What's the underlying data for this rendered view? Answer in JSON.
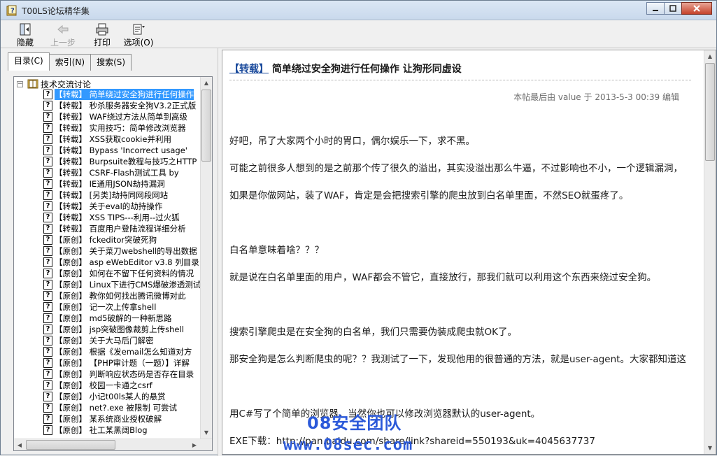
{
  "window": {
    "title": "T00LS论坛精华集"
  },
  "toolbar": {
    "hide_label": "隐藏",
    "back_label": "上一步",
    "print_label": "打印",
    "options_label": "选项(O)"
  },
  "tabs": [
    {
      "label": "目录(C)"
    },
    {
      "label": "索引(N)"
    },
    {
      "label": "搜索(S)"
    }
  ],
  "tree": {
    "root_label": "技术交流讨论",
    "items": [
      "【转载】 简单绕过安全狗进行任何操作",
      "【转载】 秒杀服务器安全狗V3.2正式版",
      "【转载】 WAF绕过方法从简单到高级",
      "【转载】 实用技巧：简单修改浏览器",
      "【转载】 XSS获取cookie并利用",
      "【转载】 Bypass 'Incorrect usage'",
      "【转载】 Burpsuite教程与技巧之HTTP",
      "【转载】 CSRF-Flash测试工具 by",
      "【转载】 IE通用JSON劫持漏洞",
      "【转载】 [另类]劫持同网段网站",
      "【转载】 关于eval的劫持操作",
      "【转载】 XSS TIPS---利用--过火狐",
      "【转载】 百度用户登陆流程详细分析",
      "【原创】 fckeditor突破死狗",
      "【原创】 关于菜刀webshell的导出数据",
      "【原创】 asp eWebEditor v3.8 列目录",
      "【原创】 如何在不留下任何资料的情况",
      "【原创】 Linux下进行CMS爆破渗透测试",
      "【原创】 教你如何找出腾讯微博对此",
      "【原创】 记一次上传拿shell",
      "【原创】 md5破解的一种新思路",
      "【原创】 jsp突破图像裁剪上传shell",
      "【原创】 关于大马后门解密",
      "【原创】 根据《发email怎么知道对方",
      "【原创】 【PHP审计题（一题）】详解",
      "【原创】 判断响应状态码是否存在目录",
      "【原创】 校园一卡通之csrf",
      "【原创】 小记t00ls某人的悬赏",
      "【原创】 net?.exe 被限制 可尝试",
      "【原创】 某系统商业授权破解",
      "【原创】 社工某黑阔Blog"
    ]
  },
  "article": {
    "title_tag": "【转载】",
    "title_text": "简单绕过安全狗进行任何操作  让狗形同虚设",
    "edit_note": "本帖最后由 value 于 2013-5-3 00:39 编辑",
    "paragraphs": [
      "好吧，吊了大家两个小时的胃口，偶尔娱乐一下，求不黑。",
      "可能之前很多人想到的是之前那个传了很久的溢出，其实没溢出那么牛逼，不过影响也不小，一个逻辑漏洞，",
      "如果是你做网站，装了WAF，肯定是会把搜索引擎的爬虫放到白名单里面，不然SEO就蛋疼了。",
      "白名单意味着啥？？？",
      "就是说在白名单里面的用户，WAF都会不管它，直接放行，那我们就可以利用这个东西来绕过安全狗。",
      "搜索引擎爬虫是在安全狗的白名单，我们只需要伪装成爬虫就OK了。",
      "那安全狗是怎么判断爬虫的呢？？我测试了一下，发现他用的很普通的方法，就是user-agent。大家都知道这",
      "用C#写了个简单的浏览器，当然你也可以修改浏览器默认的user-agent。",
      "EXE下载：http://pan.baidu.com/share/link?shareid=550193&uk=4045637737"
    ]
  },
  "watermark": {
    "line1": "08安全团队",
    "line2": "www.08sec.com"
  }
}
